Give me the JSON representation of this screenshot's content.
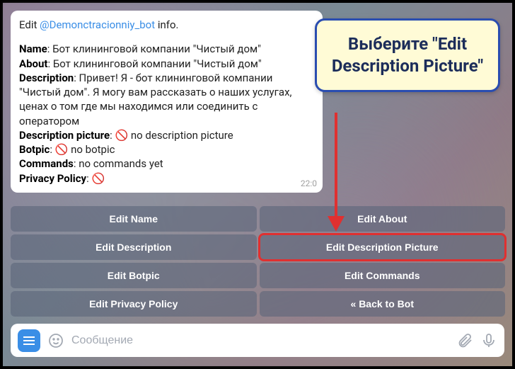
{
  "message": {
    "prefix": "Edit ",
    "mention": "@Demonctracionniy_bot",
    "suffix": " info.",
    "name_label": "Name",
    "name_value": ": Бот клининговой компании \"Чистый дом\"",
    "about_label": "About",
    "about_value": ": Бот клининговой компании \"Чистый дом\"",
    "desc_label": "Description",
    "desc_value": ": Привет! Я - бот клининговой компании \"Чистый дом\". Я могу вам рассказать о наших услугах, ценах о том где мы находимся или соединить с оператором",
    "descpic_label": "Description picture",
    "descpic_value": " no description picture",
    "botpic_label": "Botpic",
    "botpic_value": " no botpic",
    "commands_label": "Commands",
    "commands_value": ": no commands yet",
    "privacy_label": "Privacy Policy",
    "privacy_value": ": ",
    "time": "22:0",
    "prohibit_icon": "🚫"
  },
  "keyboard": {
    "r0c0": "Edit Name",
    "r0c1": "Edit About",
    "r1c0": "Edit Description",
    "r1c1": "Edit Description Picture",
    "r2c0": "Edit Botpic",
    "r2c1": "Edit Commands",
    "r3c0": "Edit Privacy Policy",
    "r3c1": "« Back to Bot"
  },
  "input": {
    "placeholder": "Сообщение"
  },
  "callout": {
    "text": "Выберите \"Edit Description Picture\""
  }
}
